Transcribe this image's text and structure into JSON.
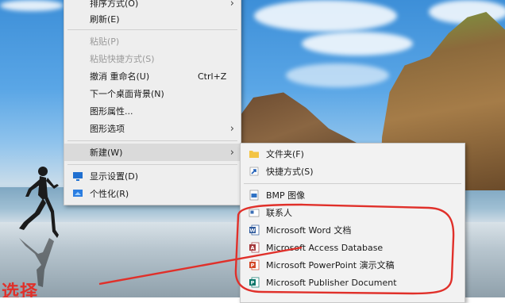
{
  "desktop": {
    "overlay_text": "选择"
  },
  "context_menu": {
    "items": [
      {
        "label": "排序方式(O)",
        "has_submenu": true
      },
      {
        "label": "刷新(E)"
      },
      {
        "label": "粘贴(P)",
        "disabled": true
      },
      {
        "label": "粘贴快捷方式(S)",
        "disabled": true
      },
      {
        "label": "撤消 重命名(U)",
        "shortcut": "Ctrl+Z"
      },
      {
        "label": "下一个桌面背景(N)"
      },
      {
        "label": "图形属性..."
      },
      {
        "label": "图形选项",
        "has_submenu": true
      },
      {
        "label": "新建(W)",
        "has_submenu": true,
        "highlighted": true
      },
      {
        "label": "显示设置(D)",
        "icon": "display-icon"
      },
      {
        "label": "个性化(R)",
        "icon": "personalize-icon"
      }
    ]
  },
  "new_submenu": {
    "items": [
      {
        "label": "文件夹(F)",
        "icon": "folder-icon"
      },
      {
        "label": "快捷方式(S)",
        "icon": "shortcut-icon"
      },
      {
        "label": "BMP 图像",
        "icon": "bmp-icon"
      },
      {
        "label": "联系人",
        "icon": "contact-icon"
      },
      {
        "label": "Microsoft Word 文档",
        "icon": "word-icon"
      },
      {
        "label": "Microsoft Access Database",
        "icon": "access-icon"
      },
      {
        "label": "Microsoft PowerPoint 演示文稿",
        "icon": "powerpoint-icon"
      },
      {
        "label": "Microsoft Publisher Document",
        "icon": "publisher-icon"
      }
    ]
  },
  "colors": {
    "annotation": "#e0302a",
    "menu_bg": "#eeeeee",
    "menu_highlight": "#dadada"
  }
}
